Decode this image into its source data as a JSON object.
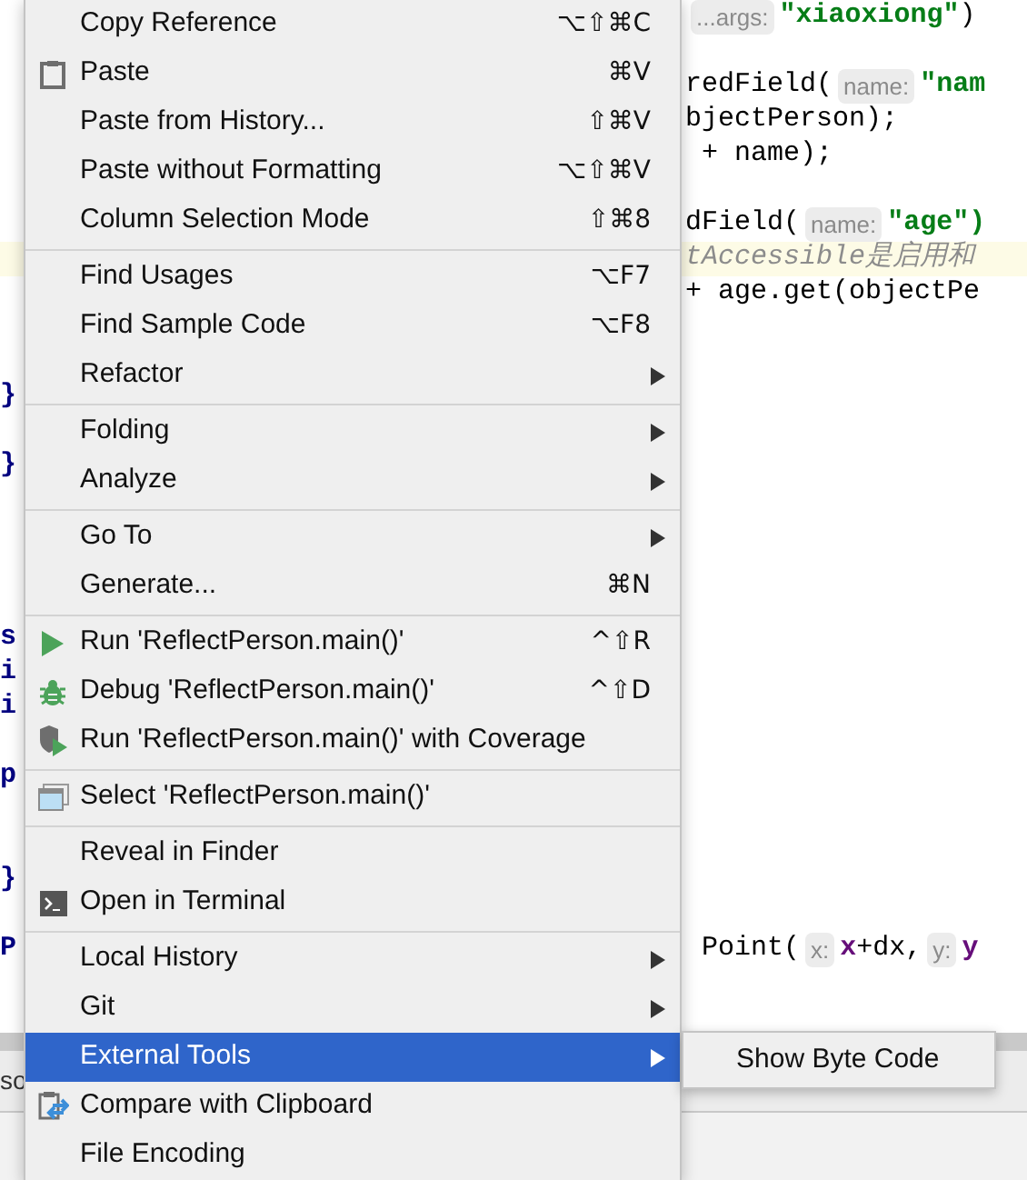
{
  "editor": {
    "lines": [
      {
        "code": [
          {
            "kind": "hint",
            "text": "...args:"
          },
          {
            "kind": "string",
            "text": "\"xiaoxiong\""
          },
          {
            "kind": "plain",
            "text": ")"
          }
        ]
      },
      {
        "code": [
          {
            "kind": "plain",
            "text": "redField("
          },
          {
            "kind": "hint",
            "text": "name:"
          },
          {
            "kind": "string",
            "text": "\"nam"
          }
        ]
      },
      {
        "code": [
          {
            "kind": "plain",
            "text": "bjectPerson);"
          }
        ]
      },
      {
        "code": [
          {
            "kind": "plain",
            "text": " + name);"
          }
        ]
      },
      {
        "code": [
          {
            "kind": "plain",
            "text": "dField("
          },
          {
            "kind": "hint",
            "text": "name:"
          },
          {
            "kind": "string",
            "text": "\"age\")"
          }
        ]
      },
      {
        "highlight": true,
        "code": [
          {
            "kind": "comment",
            "text": "tAccessible是启用和"
          }
        ]
      },
      {
        "code": [
          {
            "kind": "plain",
            "text": "+ age.get(objectPe"
          }
        ]
      },
      {
        "gutter": "}"
      },
      {
        "gutter": "}"
      },
      {
        "gutter": "s"
      },
      {
        "gutter": "i"
      },
      {
        "gutter": "i"
      },
      {
        "gutter": "p"
      },
      {
        "gutter": "}"
      },
      {
        "gutter": "P",
        "code": [
          {
            "kind": "plain",
            "text": " Point("
          },
          {
            "kind": "hint",
            "text": "x:"
          },
          {
            "kind": "field",
            "text": "x"
          },
          {
            "kind": "plain",
            "text": "+dx,"
          },
          {
            "kind": "hint",
            "text": "y:"
          },
          {
            "kind": "field",
            "text": "y"
          }
        ]
      }
    ]
  },
  "bottom_panel": {
    "text": "so"
  },
  "menu": {
    "groups": [
      [
        {
          "label": "Copy Reference",
          "shortcut": "⌥⇧⌘C",
          "submenu": false,
          "selected": false
        },
        {
          "label": "Paste",
          "shortcut": "⌘V",
          "submenu": false,
          "selected": false
        },
        {
          "label": "Paste from History...",
          "shortcut": "⇧⌘V",
          "submenu": false,
          "selected": false
        },
        {
          "label": "Paste without Formatting",
          "shortcut": "⌥⇧⌘V",
          "submenu": false,
          "selected": false
        },
        {
          "label": "Column Selection Mode",
          "shortcut": "⇧⌘8",
          "submenu": false,
          "selected": false
        }
      ],
      [
        {
          "label": "Find Usages",
          "shortcut": "⌥F7",
          "submenu": false,
          "selected": false
        },
        {
          "label": "Find Sample Code",
          "shortcut": "⌥F8",
          "submenu": false,
          "selected": false
        },
        {
          "label": "Refactor",
          "submenu": true,
          "selected": false
        }
      ],
      [
        {
          "label": "Folding",
          "submenu": true,
          "selected": false
        },
        {
          "label": "Analyze",
          "submenu": true,
          "selected": false
        }
      ],
      [
        {
          "label": "Go To",
          "submenu": true,
          "selected": false
        },
        {
          "label": "Generate...",
          "shortcut": "⌘N",
          "submenu": false,
          "selected": false
        }
      ],
      [
        {
          "label": "Run 'ReflectPerson.main()'",
          "shortcut": "^⇧R",
          "submenu": false,
          "selected": false
        },
        {
          "label": "Debug 'ReflectPerson.main()'",
          "shortcut": "^⇧D",
          "submenu": false,
          "selected": false
        },
        {
          "label": "Run 'ReflectPerson.main()' with Coverage",
          "submenu": false,
          "selected": false
        }
      ],
      [
        {
          "label": "Select 'ReflectPerson.main()'",
          "submenu": false,
          "selected": false
        }
      ],
      [
        {
          "label": "Reveal in Finder",
          "submenu": false,
          "selected": false
        },
        {
          "label": "Open in Terminal",
          "submenu": false,
          "selected": false
        }
      ],
      [
        {
          "label": "Local History",
          "submenu": true,
          "selected": false
        },
        {
          "label": "Git",
          "submenu": true,
          "selected": false
        },
        {
          "label": "External Tools",
          "submenu": true,
          "selected": true
        },
        {
          "label": "Compare with Clipboard",
          "submenu": false,
          "selected": false
        },
        {
          "label": "File Encoding",
          "submenu": false,
          "selected": false
        }
      ]
    ]
  },
  "submenu": {
    "items": [
      {
        "label": "Show Byte Code",
        "selected": false
      }
    ]
  }
}
